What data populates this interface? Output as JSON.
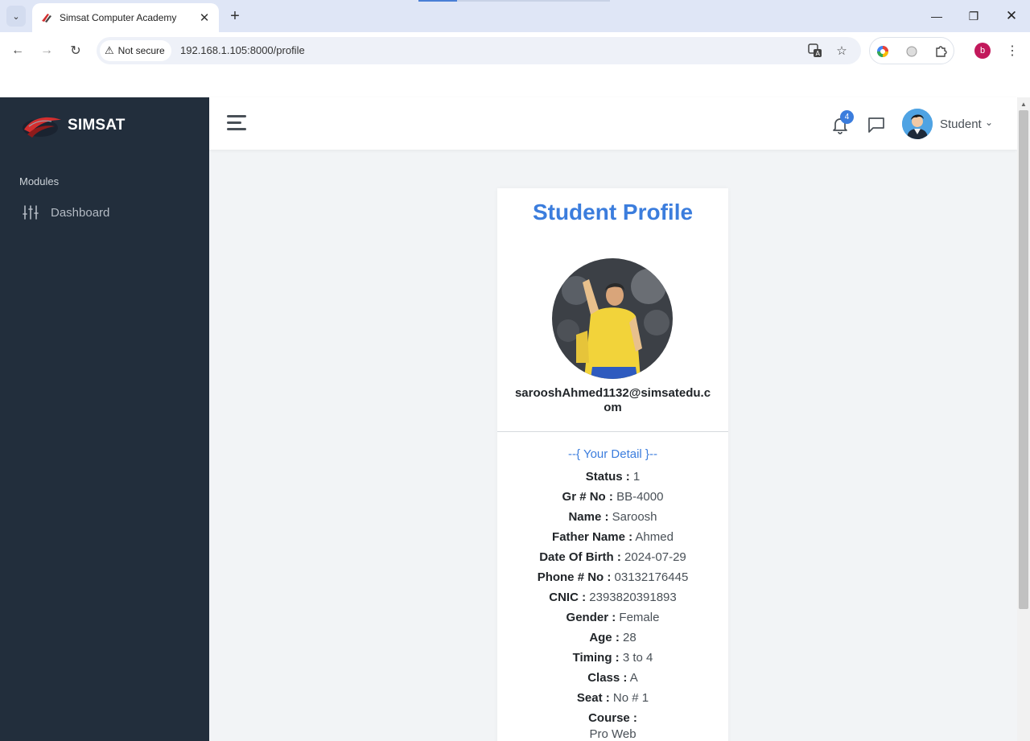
{
  "browser": {
    "tab_title": "Simsat Computer Academy",
    "security_label": "Not secure",
    "url": "192.168.1.105:8000/profile",
    "profile_initial": "b",
    "icons": [
      "tab-list-icon",
      "close-icon",
      "new-tab-icon",
      "minimize-icon",
      "restore-icon",
      "window-close-icon",
      "back-icon",
      "forward-icon",
      "reload-icon",
      "warning-icon",
      "translate-icon",
      "star-icon",
      "extension-color-icon",
      "extension-cloud-icon",
      "puzzle-icon",
      "menu-kebab-icon"
    ]
  },
  "sidebar": {
    "brand": "SIMSAT",
    "header": "Modules",
    "items": [
      {
        "label": "Dashboard",
        "icon": "sliders-icon"
      }
    ]
  },
  "topnav": {
    "notification_count": "4",
    "user_label": "Student",
    "icons": [
      "hamburger-icon",
      "bell-icon",
      "chat-icon",
      "chevron-down-icon"
    ]
  },
  "profile": {
    "title": "Student Profile",
    "email": "sarooshAhmed1132@simsatedu.com",
    "detail_heading": "--{ Your Detail }--",
    "fields": [
      {
        "key": "Status :",
        "value": "1"
      },
      {
        "key": "Gr # No :",
        "value": "BB-4000"
      },
      {
        "key": "Name :",
        "value": "Saroosh"
      },
      {
        "key": "Father Name :",
        "value": "Ahmed"
      },
      {
        "key": "Date Of Birth :",
        "value": "2024-07-29"
      },
      {
        "key": "Phone # No :",
        "value": "03132176445"
      },
      {
        "key": "CNIC :",
        "value": "2393820391893"
      },
      {
        "key": "Gender :",
        "value": "Female"
      },
      {
        "key": "Age :",
        "value": "28"
      },
      {
        "key": "Timing :",
        "value": "3 to 4"
      },
      {
        "key": "Class :",
        "value": "A"
      },
      {
        "key": "Seat :",
        "value": "No # 1"
      }
    ],
    "course": {
      "key": "Course :",
      "value": "Pro Web"
    }
  },
  "colors": {
    "accent": "#3b7ddd",
    "sidebar_bg": "#222e3c",
    "page_bg": "#f2f4f6",
    "profile_dot": "#c2185b"
  }
}
